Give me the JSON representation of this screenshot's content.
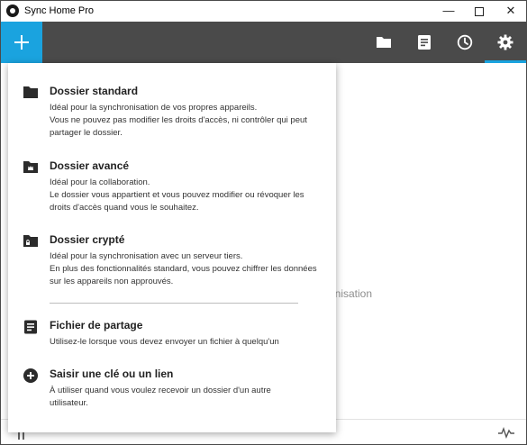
{
  "app": {
    "title": "Sync Home Pro"
  },
  "window_controls": {
    "minimize": "—",
    "close": "✕"
  },
  "toolbar": {
    "add_icon": "plus-icon",
    "icons": [
      "folder-icon",
      "notes-icon",
      "history-icon",
      "settings-icon"
    ],
    "accent": "#1aa3df",
    "background": "#4a4a4a"
  },
  "main": {
    "background_text": "ronisation"
  },
  "menu": {
    "items": [
      {
        "title": "Dossier standard",
        "desc": "Idéal pour la synchronisation de vos propres appareils.\nVous ne pouvez pas modifier les droits d'accès, ni contrôler qui peut partager le dossier.",
        "icon": "folder-icon"
      },
      {
        "title": "Dossier avancé",
        "desc": "Idéal pour la collaboration.\nLe dossier vous appartient et vous pouvez modifier ou révoquer les droits d'accès quand vous le souhaitez.",
        "icon": "crown-folder-icon"
      },
      {
        "title": "Dossier crypté",
        "desc": "Idéal pour la synchronisation avec un serveur tiers.\nEn plus des fonctionnalités standard, vous pouvez chiffrer les données sur les appareils non approuvés.",
        "icon": "lock-folder-icon"
      },
      {
        "title": "Fichier de partage",
        "desc": "Utilisez-le lorsque vous devez envoyer un fichier à quelqu'un",
        "icon": "file-share-icon"
      },
      {
        "title": "Saisir une clé ou un lien",
        "desc": "À utiliser quand vous voulez recevoir un dossier d'un autre\nutilisateur.",
        "icon": "add-circle-icon"
      }
    ]
  },
  "statusbar": {
    "icons": [
      "pause-icon",
      "activity-icon"
    ]
  }
}
